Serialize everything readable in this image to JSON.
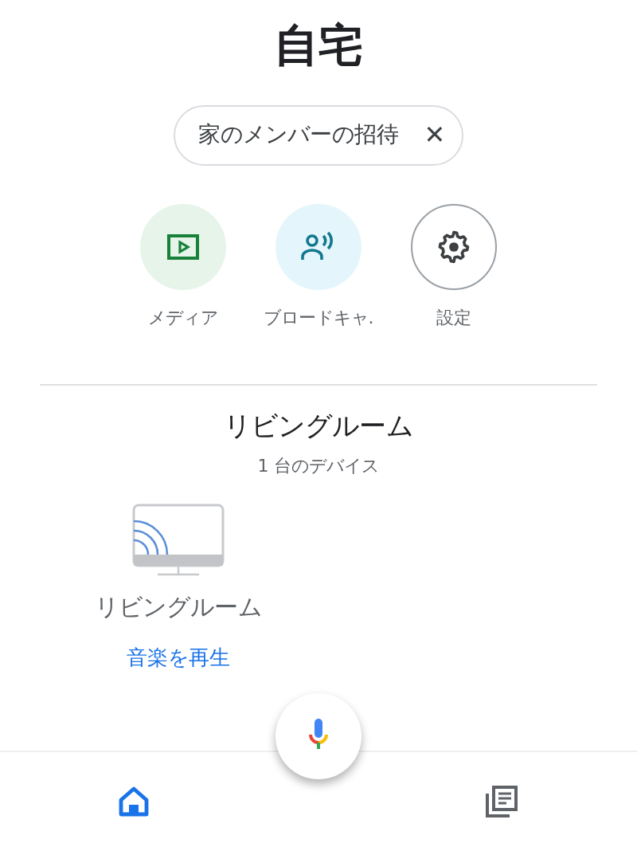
{
  "title": "自宅",
  "invite_chip": {
    "label": "家のメンバーの招待",
    "close": "✕"
  },
  "actions": [
    {
      "kind": "media",
      "label": "メディア"
    },
    {
      "kind": "broadcast",
      "label": "ブロードキャ."
    },
    {
      "kind": "settings",
      "label": "設定"
    }
  ],
  "room": {
    "name": "リビングルーム",
    "device_count": "1 台のデバイス",
    "devices": [
      {
        "name": "リビングルーム",
        "action": "音楽を再生"
      }
    ]
  },
  "bottom_nav": [
    {
      "kind": "home",
      "selected": true
    },
    {
      "kind": "feed",
      "selected": false
    }
  ]
}
